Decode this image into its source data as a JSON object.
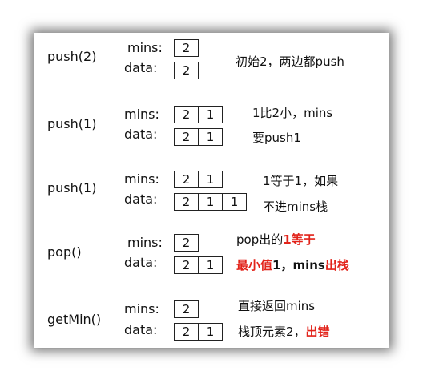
{
  "steps": [
    {
      "op": "push(2)",
      "mins_label": "mins:",
      "data_label": "data:",
      "mins": [
        "2"
      ],
      "data": [
        "2"
      ],
      "note_line1": [
        {
          "text": "初始2，两边都push",
          "style": "plain"
        }
      ],
      "note_line2": []
    },
    {
      "op": "push(1)",
      "mins_label": "mins:",
      "data_label": "data:",
      "mins": [
        "2",
        "1"
      ],
      "data": [
        "2",
        "1"
      ],
      "note_line1": [
        {
          "text": "1比2小，mins",
          "style": "plain"
        }
      ],
      "note_line2": [
        {
          "text": "要push1",
          "style": "plain"
        }
      ]
    },
    {
      "op": "push(1)",
      "mins_label": "mins:",
      "data_label": "data:",
      "mins": [
        "2",
        "1"
      ],
      "data": [
        "2",
        "1",
        "1"
      ],
      "note_line1": [
        {
          "text": "1等于1，如果",
          "style": "plain"
        }
      ],
      "note_line2": [
        {
          "text": "不进mins栈",
          "style": "plain"
        }
      ]
    },
    {
      "op": "pop()",
      "mins_label": "mins:",
      "data_label": "data:",
      "mins": [
        "2"
      ],
      "data": [
        "2",
        "1"
      ],
      "note_line1": [
        {
          "text": "pop出的",
          "style": "plain"
        },
        {
          "text": "1等于",
          "style": "red"
        }
      ],
      "note_line2": [
        {
          "text": "最小值",
          "style": "red"
        },
        {
          "text": "1，mins",
          "style": "bold"
        },
        {
          "text": "出栈",
          "style": "red"
        }
      ]
    },
    {
      "op": "getMin()",
      "mins_label": "mins:",
      "data_label": "data:",
      "mins": [
        "2"
      ],
      "data": [
        "2",
        "1"
      ],
      "note_line1": [
        {
          "text": "直接返回mins",
          "style": "plain"
        }
      ],
      "note_line2": [
        {
          "text": "栈顶元素2，",
          "style": "plain"
        },
        {
          "text": "出错",
          "style": "red"
        }
      ]
    }
  ]
}
